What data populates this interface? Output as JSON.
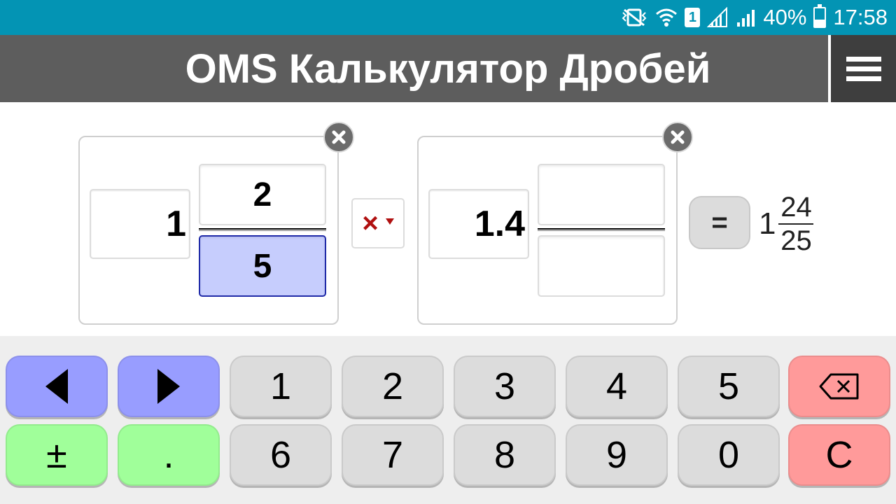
{
  "status_bar": {
    "battery": "40%",
    "battery_level": 0.4,
    "time": "17:58",
    "sim_label": "1",
    "icons": [
      "vibrate-icon",
      "wifi-icon",
      "sim-icon",
      "signal-icon",
      "signal-icon",
      "battery-icon"
    ]
  },
  "app": {
    "title": "OMS Калькулятор Дробей",
    "menu_icon": "hamburger-menu-icon"
  },
  "fraction1": {
    "whole": "1",
    "numerator": "2",
    "denominator": "5",
    "active_field": "denominator"
  },
  "operator": {
    "symbol": "×"
  },
  "fraction2": {
    "whole": "1.4",
    "numerator": "",
    "denominator": ""
  },
  "equals": {
    "label": "="
  },
  "result": {
    "whole": "1",
    "numerator": "24",
    "denominator": "25"
  },
  "keypad": {
    "row1": [
      "◀",
      "▶",
      "1",
      "2",
      "3",
      "4",
      "5",
      "backspace"
    ],
    "row2": [
      "±",
      ".",
      "6",
      "7",
      "8",
      "9",
      "0",
      "C"
    ],
    "colors": {
      "navigation": "#989dff",
      "modifier": "#a0ff9a",
      "digit": "#dcdcdc",
      "delete": "#ff9a9a"
    }
  },
  "colors": {
    "status_bar": "#0394b4",
    "title_bar": "#5d5d5d",
    "menu_button": "#3e3e3e",
    "active_field": "#c6cdfd",
    "operator": "#b01010"
  }
}
